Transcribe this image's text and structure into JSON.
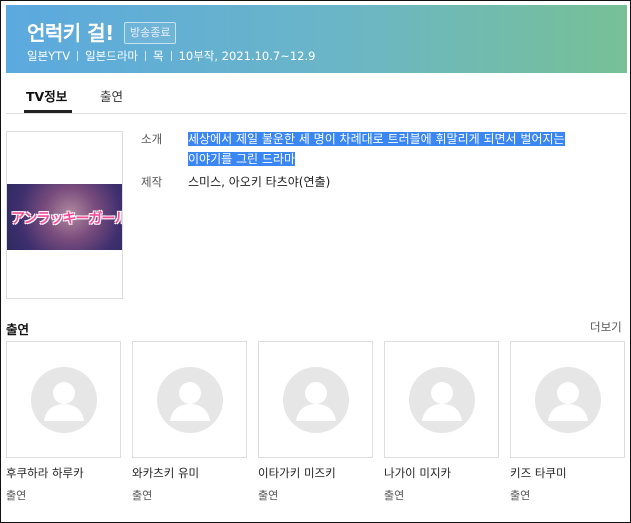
{
  "header": {
    "title": "언럭키 걸!",
    "badge": "방송종료",
    "meta": [
      "일본YTV",
      "일본드라마",
      "목",
      "10부작, 2021.10.7~12.9"
    ]
  },
  "tabs": [
    {
      "label": "TV정보",
      "active": true
    },
    {
      "label": "출연",
      "active": false
    }
  ],
  "poster": {
    "logo_text": "アンラッキーガール!"
  },
  "info": {
    "intro_label": "소개",
    "intro_line1": "세상에서 제일 불운한 세 명이 차례대로 트러블에 휘말리게 되면서 벌어지는",
    "intro_line2": "이야기를 그린 드라마",
    "prod_label": "제작",
    "prod_value": "스미스, 아오키 타츠야(연출)"
  },
  "cast": {
    "heading": "출연",
    "more": "더보기",
    "members": [
      {
        "name": "후쿠하라 하루카",
        "role": "출연"
      },
      {
        "name": "와카츠키 유미",
        "role": "출연"
      },
      {
        "name": "이타가키 미즈키",
        "role": "출연"
      },
      {
        "name": "나가이 미지카",
        "role": "출연"
      },
      {
        "name": "키즈 타쿠미",
        "role": "출연"
      }
    ]
  },
  "colors": {
    "highlight": "#3a86f2",
    "header_start": "#5ba9df",
    "header_end": "#77c096"
  }
}
